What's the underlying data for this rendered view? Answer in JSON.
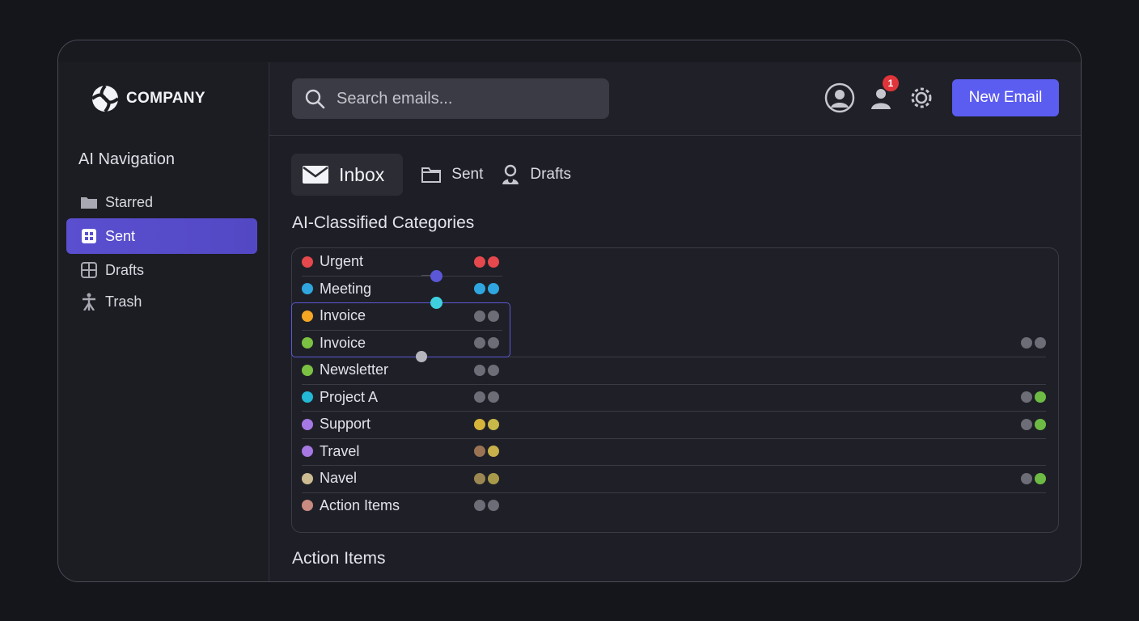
{
  "brand": {
    "name": "COMPANY"
  },
  "sidebar": {
    "heading": "AI Navigation",
    "items": [
      {
        "label": "Starred",
        "icon": "folder-icon",
        "active": false
      },
      {
        "label": "Sent",
        "icon": "grid-icon",
        "active": true
      },
      {
        "label": "Drafts",
        "icon": "grid-icon",
        "active": false
      },
      {
        "label": "Trash",
        "icon": "figure-icon",
        "active": false
      }
    ]
  },
  "header": {
    "search_placeholder": "Search emails...",
    "notification_count": "1",
    "new_email_label": "New Email"
  },
  "tabs": [
    {
      "label": "Inbox",
      "icon": "mail-icon",
      "active": true
    },
    {
      "label": "Sent",
      "icon": "folder-icon",
      "active": false
    },
    {
      "label": "Drafts",
      "icon": "user-icon",
      "active": false
    }
  ],
  "categories": {
    "title": "AI-Classified Categories",
    "items": [
      {
        "label": "Urgent",
        "color": "#e5484d",
        "pair": [
          "#e5484d",
          "#e5484d"
        ],
        "right_pair": null
      },
      {
        "label": "Meeting",
        "color": "#2fa6df",
        "pair": [
          "#2fa6df",
          "#2fa6df"
        ],
        "right_pair": null
      },
      {
        "label": "Invoice",
        "color": "#f5a623",
        "pair": [
          "#6c6d76",
          "#6c6d76"
        ],
        "right_pair": null
      },
      {
        "label": "Invoice",
        "color": "#7cc242",
        "pair": [
          "#6c6d76",
          "#6c6d76"
        ],
        "right_pair": [
          "#6c6d76",
          "#6c6d76"
        ]
      },
      {
        "label": "Newsletter",
        "color": "#7cc242",
        "pair": [
          "#6c6d76",
          "#6c6d76"
        ],
        "right_pair": null
      },
      {
        "label": "Project A",
        "color": "#22b8d6",
        "pair": [
          "#6c6d76",
          "#6c6d76"
        ],
        "right_pair": [
          "#6c6d76",
          "#6dbb44"
        ]
      },
      {
        "label": "Support",
        "color": "#a678e3",
        "pair": [
          "#d6b43a",
          "#c8b848"
        ],
        "right_pair": [
          "#6c6d76",
          "#6dbb44"
        ]
      },
      {
        "label": "Travel",
        "color": "#a678e3",
        "pair": [
          "#9a7355",
          "#c8b04a"
        ],
        "right_pair": null
      },
      {
        "label": "Navel",
        "color": "#cdbb92",
        "pair": [
          "#9c8752",
          "#a89a4a"
        ],
        "right_pair": [
          "#6c6d76",
          "#6dbb44"
        ]
      },
      {
        "label": "Action Items",
        "color": "#c98a82",
        "pair": [
          "#6c6d76",
          "#6c6d76"
        ],
        "right_pair": null
      }
    ]
  },
  "action_items": {
    "title": "Action Items"
  },
  "colors": {
    "accent": "#5b5cf0",
    "active_nav": "#5a4fcf",
    "badge": "#e0353a",
    "node_purple": "#5b57d6",
    "node_cyan": "#3fd0e0",
    "node_grey": "#b5b6bd"
  }
}
